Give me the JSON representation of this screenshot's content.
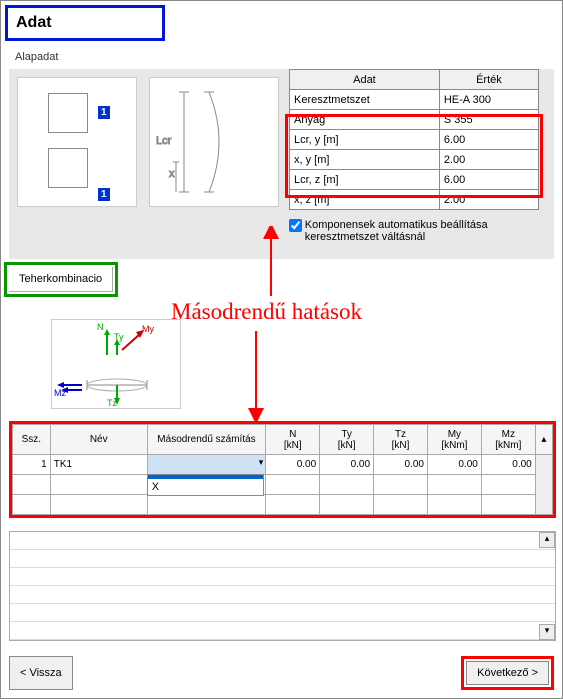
{
  "title": "Adat",
  "section_alapadat": "Alapadat",
  "diagram": {
    "badge1": "1",
    "badge2": "1",
    "lcr_label": "Lcr",
    "x_label": "x"
  },
  "props": {
    "header_adattr": "Adat",
    "header_ertek": "Érték",
    "rows": [
      {
        "attr": "Keresztmetszet",
        "val": "HE-A 300"
      },
      {
        "attr": "Anyag",
        "val": "S 355"
      },
      {
        "attr": "Lcr, y [m]",
        "val": "6.00"
      },
      {
        "attr": "x, y [m]",
        "val": "2.00"
      },
      {
        "attr": "Lcr, z [m]",
        "val": "6.00"
      },
      {
        "attr": "x, z [m]",
        "val": "2.00"
      }
    ]
  },
  "checkbox_label": "Komponensek automatikus beállítása keresztmetszet váltásnál",
  "teher_tab": "Teherkombinacio",
  "annotation": "Másodrendű hatások",
  "axis": {
    "N": "N",
    "Ty": "Ty",
    "My": "My",
    "Mz": "Mz",
    "Tz": "Tz"
  },
  "load_table": {
    "headers": {
      "ssz": "Ssz.",
      "nev": "Név",
      "masod": "Másodrendű számítás",
      "N": "N\n[kN]",
      "Ty": "Ty\n[kN]",
      "Tz": "Tz\n[kN]",
      "My": "My\n[kNm]",
      "Mz": "Mz\n[kNm]"
    },
    "row1": {
      "ssz": "1",
      "nev": "TK1",
      "masod": "",
      "N": "0.00",
      "Ty": "0.00",
      "Tz": "0.00",
      "My": "0.00",
      "Mz": "0.00"
    },
    "dropdown": {
      "opt1": "",
      "opt2": "X"
    }
  },
  "footer": {
    "back": "< Vissza",
    "next": "Következő >"
  }
}
